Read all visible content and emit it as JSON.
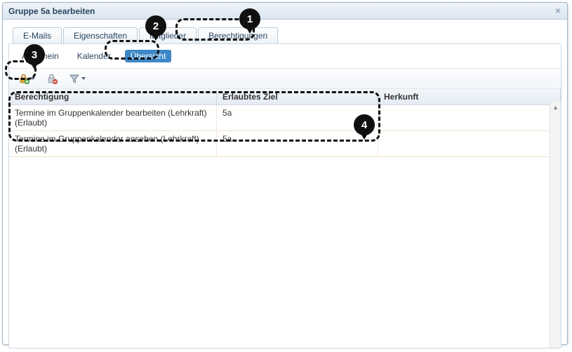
{
  "window": {
    "title": "Gruppe 5a bearbeiten"
  },
  "tabs_main": {
    "emails": "E-Mails",
    "eigenschaften": "Eigenschaften",
    "mitglieder": "Mitglieder",
    "berechtigungen": "Berechtigungen"
  },
  "tabs_sub": {
    "allgemein": "Allgemein",
    "kalender": "Kalender",
    "uebersicht": "Übersicht"
  },
  "columns": {
    "berechtigung": "Berechtigung",
    "ziel": "Erlaubtes Ziel",
    "herkunft": "Herkunft"
  },
  "rows": [
    {
      "berechtigung": "Termine im Gruppenkalender bearbeiten (Lehrkraft) (Erlaubt)",
      "ziel": "5a",
      "herkunft": ""
    },
    {
      "berechtigung": "Termine im Gruppenkalender ansehen (Lehrkraft) (Erlaubt)",
      "ziel": "5a",
      "herkunft": ""
    }
  ],
  "annotations": {
    "n1": "1",
    "n2": "2",
    "n3": "3",
    "n4": "4"
  }
}
